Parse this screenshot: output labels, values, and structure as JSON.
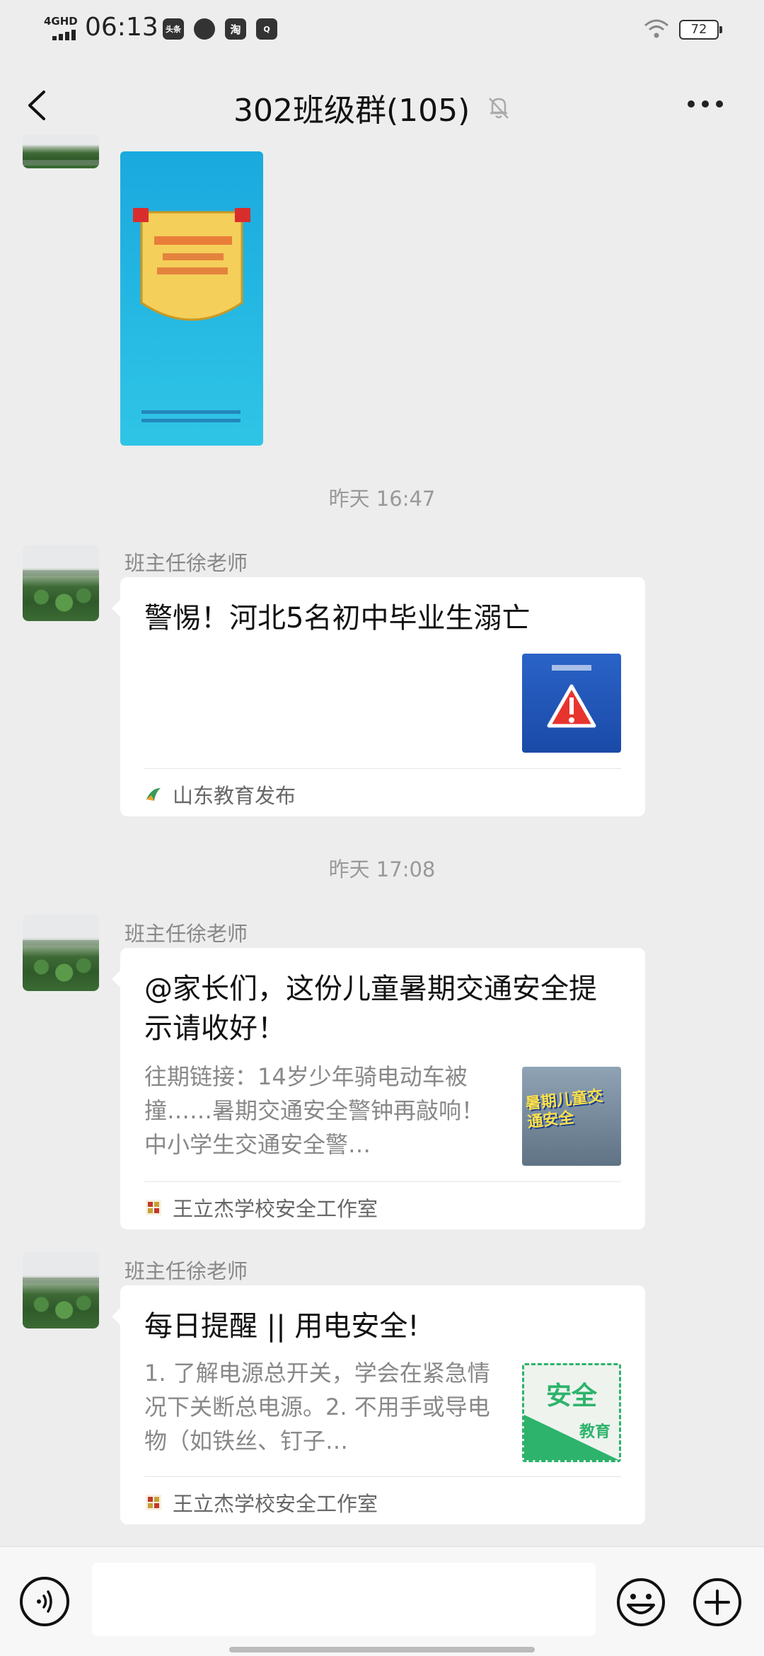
{
  "status_bar": {
    "network": "4GHD",
    "time": "06:13",
    "app_icons": [
      "头条",
      "消息",
      "淘",
      "QQ浏览器"
    ],
    "battery": "72"
  },
  "header": {
    "title": "302班级群(105)"
  },
  "messages": [
    {
      "timestamp": "昨天 16:47"
    },
    {
      "sender": "班主任徐老师",
      "title": "警惕！河北5名初中毕业生溺亡",
      "source": "山东教育发布"
    },
    {
      "timestamp": "昨天 17:08"
    },
    {
      "sender": "班主任徐老师",
      "title": "@家长们，这份儿童暑期交通安全提示请收好！",
      "desc": "往期链接：14岁少年骑电动车被撞……暑期交通安全警钟再敲响！中小学生交通安全警…",
      "thumb_text": "暑期儿童交通安全",
      "source": "王立杰学校安全工作室"
    },
    {
      "sender": "班主任徐老师",
      "title": "每日提醒 || 用电安全!",
      "desc": "1. 了解电源总开关，学会在紧急情况下关断总电源。2. 不用手或导电物（如铁丝、钉子…",
      "thumb_text": "安全",
      "thumb_text2": "教育",
      "source": "王立杰学校安全工作室"
    }
  ],
  "colors": {
    "background": "#ededed",
    "card": "#ffffff",
    "muted_text": "#888888"
  }
}
